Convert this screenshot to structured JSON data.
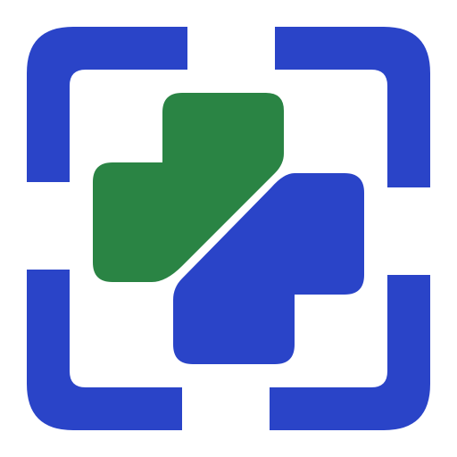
{
  "icon": {
    "name": "scan-medical-cross-icon",
    "colors": {
      "frame": "#2a44c8",
      "cross_top_left": "#2a8444",
      "cross_bottom_right": "#2a44c8",
      "background": "#ffffff"
    }
  }
}
